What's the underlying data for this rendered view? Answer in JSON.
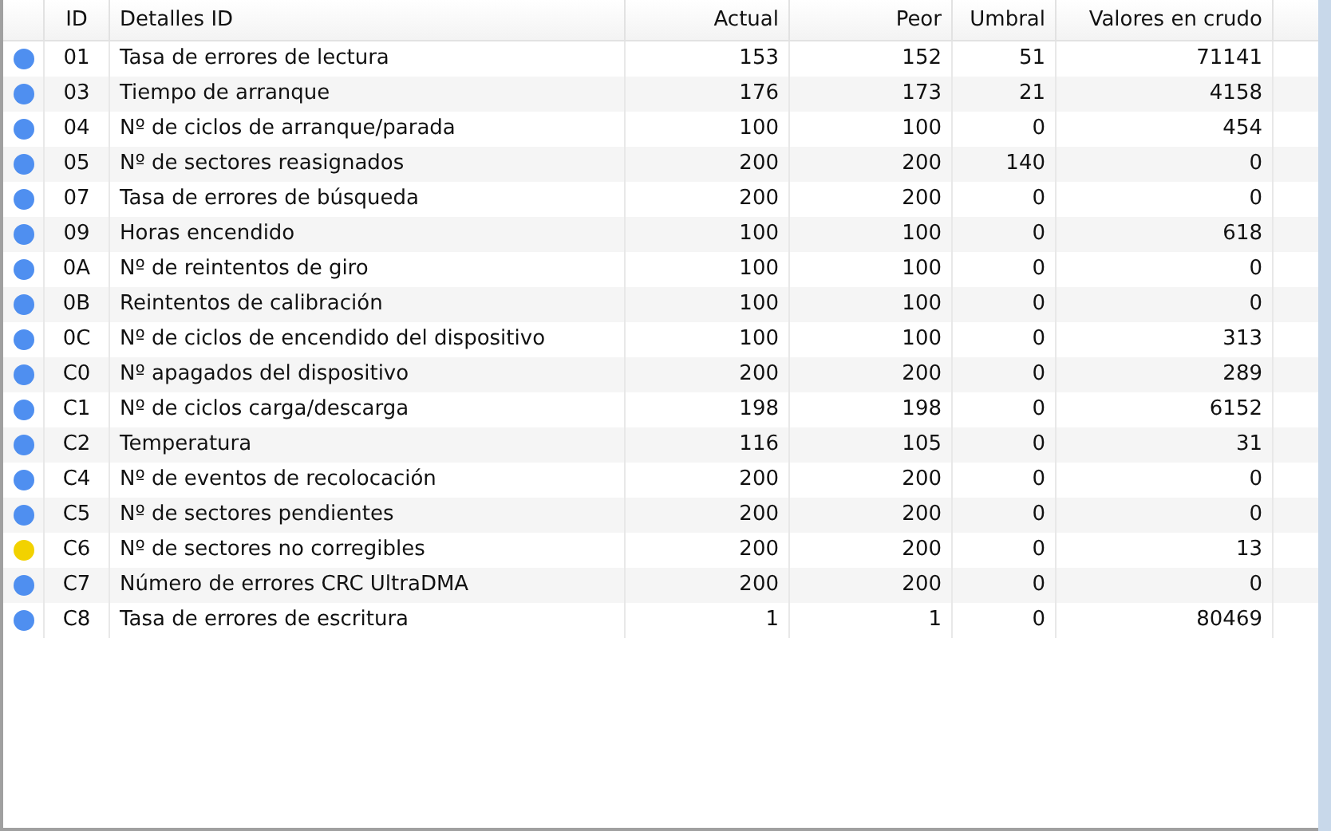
{
  "table": {
    "columns": [
      "ID",
      "Detalles ID",
      "Actual",
      "Peor",
      "Umbral",
      "Valores en crudo"
    ],
    "rows": [
      {
        "color": "#4f8ff0",
        "id": "01",
        "name": "Tasa de errores de lectura",
        "actual": "153",
        "worst": "152",
        "threshold": "51",
        "raw": "71141"
      },
      {
        "color": "#4f8ff0",
        "id": "03",
        "name": "Tiempo de arranque",
        "actual": "176",
        "worst": "173",
        "threshold": "21",
        "raw": "4158"
      },
      {
        "color": "#4f8ff0",
        "id": "04",
        "name": "Nº de ciclos de arranque/parada",
        "actual": "100",
        "worst": "100",
        "threshold": "0",
        "raw": "454"
      },
      {
        "color": "#4f8ff0",
        "id": "05",
        "name": "Nº de sectores reasignados",
        "actual": "200",
        "worst": "200",
        "threshold": "140",
        "raw": "0"
      },
      {
        "color": "#4f8ff0",
        "id": "07",
        "name": "Tasa de errores de búsqueda",
        "actual": "200",
        "worst": "200",
        "threshold": "0",
        "raw": "0"
      },
      {
        "color": "#4f8ff0",
        "id": "09",
        "name": "Horas encendido",
        "actual": "100",
        "worst": "100",
        "threshold": "0",
        "raw": "618"
      },
      {
        "color": "#4f8ff0",
        "id": "0A",
        "name": "Nº de reintentos de giro",
        "actual": "100",
        "worst": "100",
        "threshold": "0",
        "raw": "0"
      },
      {
        "color": "#4f8ff0",
        "id": "0B",
        "name": "Reintentos de calibración",
        "actual": "100",
        "worst": "100",
        "threshold": "0",
        "raw": "0"
      },
      {
        "color": "#4f8ff0",
        "id": "0C",
        "name": "Nº de ciclos de encendido del dispositivo",
        "actual": "100",
        "worst": "100",
        "threshold": "0",
        "raw": "313"
      },
      {
        "color": "#4f8ff0",
        "id": "C0",
        "name": "Nº apagados del dispositivo",
        "actual": "200",
        "worst": "200",
        "threshold": "0",
        "raw": "289"
      },
      {
        "color": "#4f8ff0",
        "id": "C1",
        "name": "Nº de ciclos carga/descarga",
        "actual": "198",
        "worst": "198",
        "threshold": "0",
        "raw": "6152"
      },
      {
        "color": "#4f8ff0",
        "id": "C2",
        "name": "Temperatura",
        "actual": "116",
        "worst": "105",
        "threshold": "0",
        "raw": "31"
      },
      {
        "color": "#4f8ff0",
        "id": "C4",
        "name": "Nº de eventos de recolocación",
        "actual": "200",
        "worst": "200",
        "threshold": "0",
        "raw": "0"
      },
      {
        "color": "#4f8ff0",
        "id": "C5",
        "name": "Nº de sectores pendientes",
        "actual": "200",
        "worst": "200",
        "threshold": "0",
        "raw": "0"
      },
      {
        "color": "#f2d200",
        "id": "C6",
        "name": "Nº de sectores no corregibles",
        "actual": "200",
        "worst": "200",
        "threshold": "0",
        "raw": "13"
      },
      {
        "color": "#4f8ff0",
        "id": "C7",
        "name": "Número de errores CRC UltraDMA",
        "actual": "200",
        "worst": "200",
        "threshold": "0",
        "raw": "0"
      },
      {
        "color": "#4f8ff0",
        "id": "C8",
        "name": "Tasa de errores de escritura",
        "actual": "1",
        "worst": "1",
        "threshold": "0",
        "raw": "80469"
      }
    ]
  }
}
